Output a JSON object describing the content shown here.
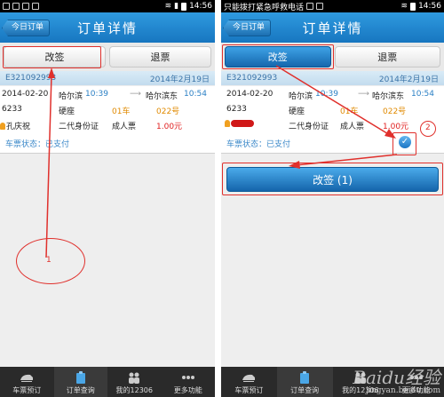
{
  "left": {
    "status_time": "14:56",
    "nav_back": "今日订单",
    "title": "订单详情",
    "segments": [
      "改签",
      "退票"
    ],
    "order_no": "E321092993",
    "order_date": "2014年2月19日",
    "ticket": {
      "date": "2014-02-20",
      "from": "哈尔滨",
      "dep_time": "10:39",
      "to": "哈尔滨东",
      "arr_time": "10:54",
      "train": "6233",
      "seat_type": "硬座",
      "car": "01车",
      "seat": "022号",
      "passenger": "孔庆祝",
      "id_type": "二代身份证",
      "ticket_type": "成人票",
      "price": "1.00元",
      "status": "车票状态：已支付"
    },
    "annotation": "1"
  },
  "right": {
    "status_notice": "只能拨打紧急呼救电话",
    "status_time": "14:56",
    "nav_back": "今日订单",
    "title": "订单详情",
    "segments": [
      "改签",
      "退票"
    ],
    "order_no": "E321092993",
    "order_date": "2014年2月19日",
    "ticket": {
      "date": "2014-02-20",
      "from": "哈尔滨",
      "dep_time": "10:39",
      "to": "哈尔滨东",
      "arr_time": "10:54",
      "train": "6233",
      "seat_type": "硬座",
      "car": "01车",
      "seat": "022号",
      "id_type": "二代身份证",
      "ticket_type": "成人票",
      "price": "1.00元",
      "status": "车票状态：已支付"
    },
    "change_button": "改签 (1)",
    "annotation": "2"
  },
  "tabs": [
    "车票预订",
    "订单查询",
    "我的12306",
    "更多功能"
  ],
  "watermark": {
    "brand": "Baidu经验",
    "url": "jingyan.baidu.com"
  },
  "colors": {
    "accent": "#1b7cc8",
    "annotation": "#e0302c",
    "price": "#e02020"
  }
}
